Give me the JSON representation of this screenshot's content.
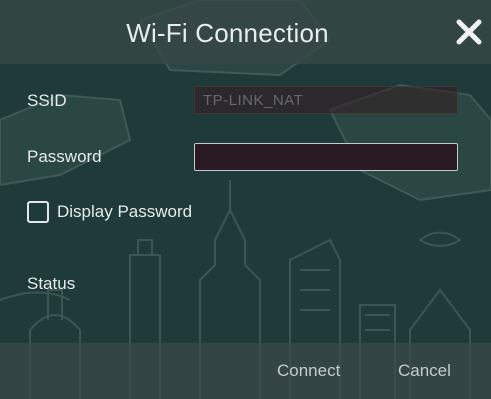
{
  "dialog": {
    "title": "Wi-Fi Connection",
    "close_icon": "close-icon"
  },
  "form": {
    "ssid_label": "SSID",
    "ssid_value": "TP-LINK_NAT",
    "password_label": "Password",
    "password_value": "",
    "display_password_label": "Display Password",
    "display_password_checked": false,
    "status_label": "Status",
    "status_value": ""
  },
  "footer": {
    "connect_label": "Connect",
    "cancel_label": "Cancel"
  }
}
